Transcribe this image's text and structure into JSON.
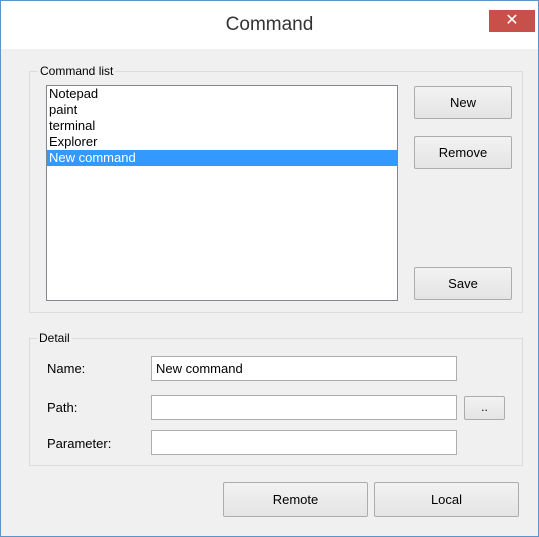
{
  "window": {
    "title": "Command",
    "close_symbol": "✕"
  },
  "command_list": {
    "label": "Command list",
    "items": [
      "Notepad",
      "paint",
      "terminal",
      "Explorer",
      "New command"
    ],
    "selected_index": 4,
    "new_label": "New",
    "remove_label": "Remove",
    "save_label": "Save"
  },
  "detail": {
    "label": "Detail",
    "name_label": "Name:",
    "name_value": "New command",
    "path_label": "Path:",
    "path_value": "",
    "browse_label": "..",
    "parameter_label": "Parameter:",
    "parameter_value": ""
  },
  "footer": {
    "remote_label": "Remote",
    "local_label": "Local"
  },
  "colors": {
    "selection": "#3399ff",
    "close_button": "#c7504a",
    "window_border": "#5d93c9"
  },
  "icons": {
    "close": "close-icon"
  }
}
